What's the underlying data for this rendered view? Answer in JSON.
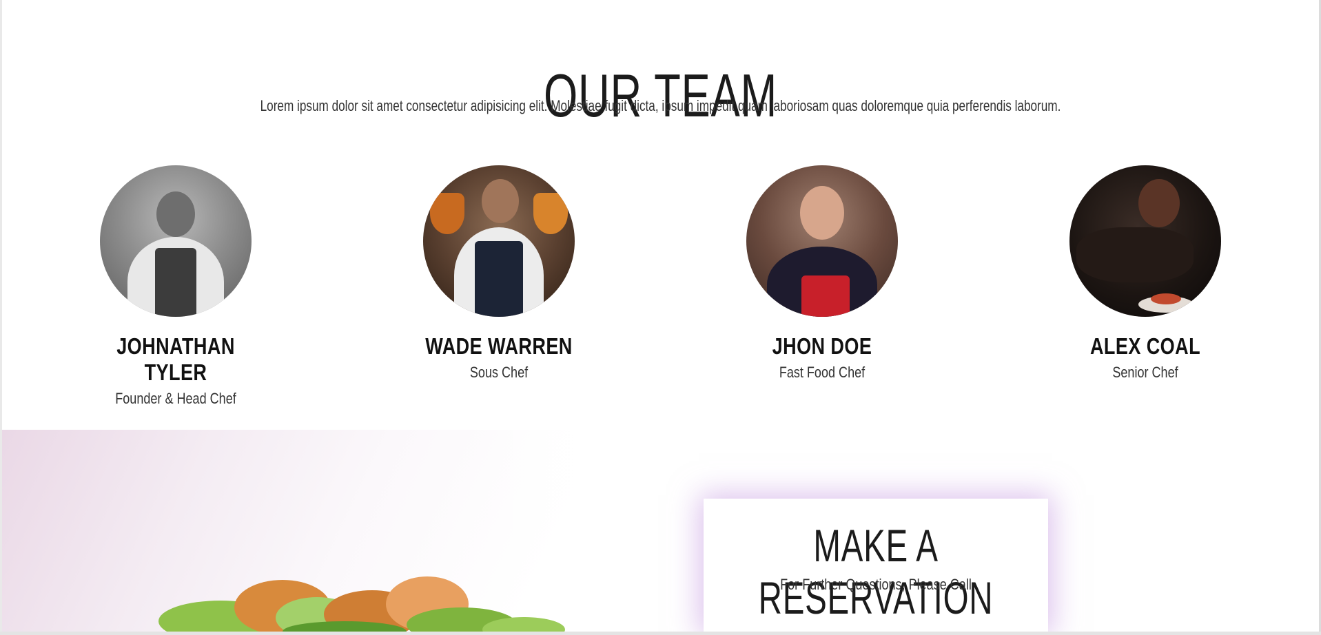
{
  "team": {
    "title": "OUR TEAM",
    "intro": "Lorem ipsum dolor sit amet consectetur adipisicing elit. Molestiae fugit dicta, ipsum impedit quam laboriosam quas doloremque quia perferendis laborum.",
    "members": [
      {
        "name": "JOHNATHAN TYLER",
        "role": "Founder & Head Chef"
      },
      {
        "name": "WADE WARREN",
        "role": "Sous Chef"
      },
      {
        "name": "JHON DOE",
        "role": "Fast Food Chef"
      },
      {
        "name": "ALEX COAL",
        "role": "Senior Chef"
      }
    ]
  },
  "reservation": {
    "title": "MAKE A RESERVATION",
    "subtitle": "For Further Questions, Please Call"
  }
}
